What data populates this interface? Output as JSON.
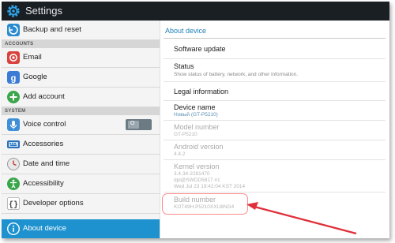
{
  "app": {
    "title": "Settings"
  },
  "sidebar": {
    "items": [
      {
        "label": "Backup and reset",
        "icon": "backup-icon"
      },
      {
        "label": "Email",
        "icon": "email-icon"
      },
      {
        "label": "Google",
        "icon": "google-icon"
      },
      {
        "label": "Add account",
        "icon": "add-account-icon"
      },
      {
        "label": "Voice control",
        "icon": "microphone-icon",
        "toggle": "O"
      },
      {
        "label": "Accessories",
        "icon": "keyboard-icon"
      },
      {
        "label": "Date and time",
        "icon": "clock-icon"
      },
      {
        "label": "Accessibility",
        "icon": "accessibility-icon"
      },
      {
        "label": "Developer options",
        "icon": "developer-braces-icon"
      },
      {
        "label": "About device",
        "icon": "info-icon",
        "selected": true
      }
    ],
    "sections": {
      "accounts": "ACCOUNTS",
      "system": "SYSTEM"
    }
  },
  "detail": {
    "header": "About device",
    "items": [
      {
        "title": "Software update"
      },
      {
        "title": "Status",
        "subtitle": "Show status of battery, network, and other information."
      },
      {
        "title": "Legal information"
      },
      {
        "title": "Device name",
        "subtitle": "Новый (GT-P5210)"
      },
      {
        "title": "Model number",
        "subtitle": "GT-P5210"
      },
      {
        "title": "Android version",
        "subtitle": "4.4.2"
      },
      {
        "title": "Kernel version",
        "subtitle_lines": [
          "3.4.34-2281470",
          "dpi@SWDD5817 #1",
          "Wed Jul 23 19:42:04 KST 2014"
        ]
      },
      {
        "title": "Build number",
        "subtitle": "KOT49H.P5210XXU8NG4"
      }
    ]
  },
  "colors": {
    "titlebar": "#1a1f24",
    "selected": "#1e92cf",
    "accent_text": "#1e7fb8",
    "annotation": "#e0303a"
  }
}
